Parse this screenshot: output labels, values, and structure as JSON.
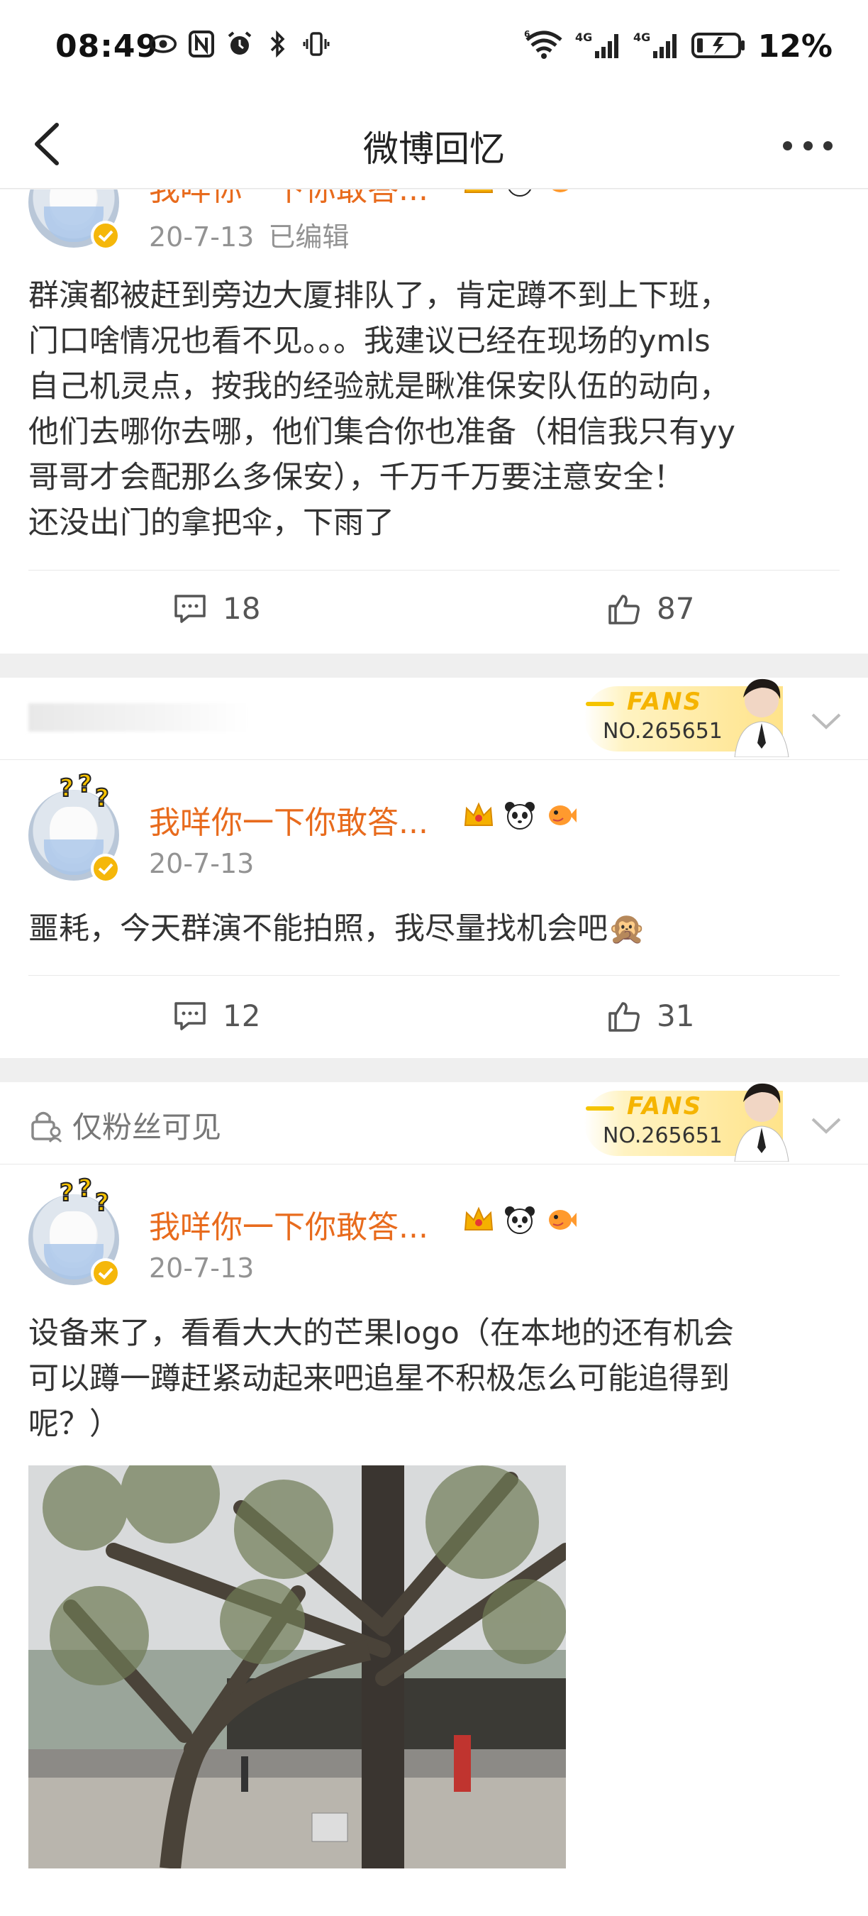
{
  "status_bar": {
    "time": "08:49",
    "battery": "12%",
    "network1": "4G",
    "network2": "4G",
    "wifi_sub": "6"
  },
  "nav": {
    "title": "微博回忆",
    "back_icon": "chevron-left-icon",
    "more_icon": "more-dots-icon"
  },
  "posts": [
    {
      "username": "我咩你一下你敢答...",
      "time": "20-7-13",
      "edited": "已编辑",
      "text": [
        "群演都被赶到旁边大厦排队了，肯定蹲不到上下班，",
        "门口啥情况也看不见。。。我建议已经在现场的ymls",
        "自己机灵点，按我的经验就是瞅准保安队伍的动向，",
        "他们去哪你去哪，他们集合你也准备（相信我只有yy",
        "哥哥才会配那么多保安），千万千万要注意安全！",
        "还没出门的拿把伞，下雨了"
      ],
      "comments": "18",
      "likes": "87"
    },
    {
      "username": "我咩你一下你敢答...",
      "time": "20-7-13",
      "text": [
        "噩耗，今天群演不能拍照，我尽量找机会吧🙊"
      ],
      "comments": "12",
      "likes": "31"
    },
    {
      "username": "我咩你一下你敢答...",
      "time": "20-7-13",
      "text": [
        "设备来了，看看大大的芒果logo（在本地的还有机会",
        "可以蹲一蹲赶紧动起来吧追星不积极怎么可能追得到",
        "呢？）"
      ]
    }
  ],
  "fans_badge": {
    "word": "FANS",
    "number": "NO.265651"
  },
  "privacy_label": "仅粉丝可见",
  "colors": {
    "username": "#e86b1d",
    "accent_gold": "#f5b70a",
    "text": "#333333",
    "meta": "#939393"
  },
  "icons": {
    "badges": [
      "crown-icon",
      "panda-icon",
      "fish-icon"
    ],
    "comment": "comment-icon",
    "like": "thumbs-up-icon",
    "lock": "lock-person-icon",
    "chevron": "chevron-down-icon"
  }
}
